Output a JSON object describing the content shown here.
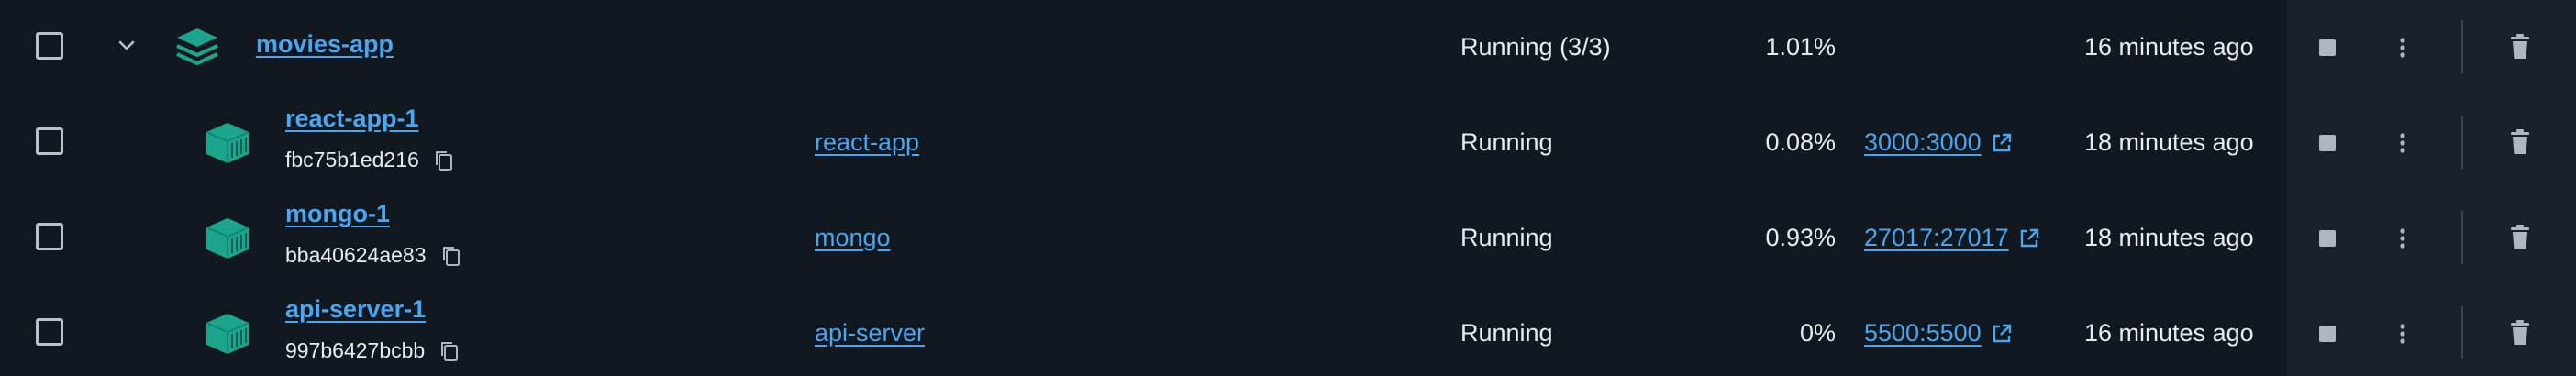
{
  "project": {
    "name": "movies-app",
    "status": "Running (3/3)",
    "cpu": "1.01%",
    "last_started": "16 minutes ago"
  },
  "containers": [
    {
      "name": "react-app-1",
      "id": "fbc75b1ed216",
      "image": "react-app",
      "status": "Running",
      "cpu": "0.08%",
      "port": "3000:3000",
      "last_started": "18 minutes ago"
    },
    {
      "name": "mongo-1",
      "id": "bba40624ae83",
      "image": "mongo",
      "status": "Running",
      "cpu": "0.93%",
      "port": "27017:27017",
      "last_started": "18 minutes ago"
    },
    {
      "name": "api-server-1",
      "id": "997b6427bcbb",
      "image": "api-server",
      "status": "Running",
      "cpu": "0%",
      "port": "5500:5500",
      "last_started": "16 minutes ago"
    }
  ],
  "icons": {
    "row_toggle": "chevron-down-icon",
    "project": "stack-icon",
    "container": "container-icon",
    "copy": "copy-icon",
    "external": "external-link-icon",
    "stop": "stop-icon",
    "more": "more-vertical-icon",
    "delete": "trash-icon"
  },
  "colors": {
    "background": "#111820",
    "actions_background": "#1a2129",
    "link": "#4aa6f0",
    "icon_teal": "#1ba58d",
    "text": "#e8ecf0"
  }
}
